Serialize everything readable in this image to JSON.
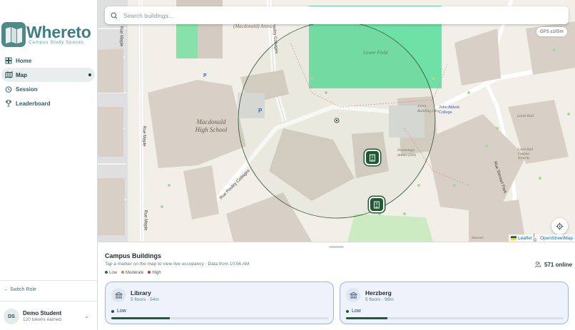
{
  "app": {
    "name": "Whereto",
    "tagline": "Campus Study Spaces"
  },
  "nav": {
    "items": [
      {
        "label": "Home",
        "icon": "home-icon"
      },
      {
        "label": "Map",
        "icon": "map-icon",
        "active": true
      },
      {
        "label": "Session",
        "icon": "timer-icon"
      },
      {
        "label": "Leaderboard",
        "icon": "trophy-icon"
      }
    ]
  },
  "sidebar": {
    "switch_role": "← Switch Role"
  },
  "user": {
    "initials": "DS",
    "name": "Demo Student",
    "tokens": "120 tokens earned"
  },
  "map": {
    "search_placeholder": "Search buildings...",
    "gps": "GPS ±105m",
    "attribution": {
      "leaflet": "Leaflet",
      "sep": " | © ",
      "osm": "OpenStreetMap"
    },
    "labels": {
      "macdonald_arena": "(Macdonald) Arena",
      "lower_field": "Lower Field",
      "macdonald_hs": "Macdonald High School",
      "jones_building": "Jones Building (JB)",
      "john_abbott": "John Abbott College",
      "laird_hall": "Laird Hall",
      "laird_security": "Laird Hall Campus Security",
      "hochelaga": "Hochelaga Annex (HA)",
      "stewart": "Stewart"
    },
    "streets": {
      "maple1": "Rue Maple",
      "maple2": "Rue Maple",
      "maple3": "Rue Maple",
      "cottages": "Rue Poultry Cottages",
      "stewart_park": "Rue Stewart Park",
      "cottages_top": "Poultry Cottages"
    }
  },
  "panel": {
    "title": "Campus Buildings",
    "subtitle": "Tap a marker on the map to view live occupancy · Data from 10:56 AM",
    "legend": [
      {
        "label": "Low",
        "color": "#2e6b3a"
      },
      {
        "label": "Moderate",
        "color": "#d08b2c"
      },
      {
        "label": "High",
        "color": "#c0392b"
      }
    ],
    "online": "571 online"
  },
  "buildings": [
    {
      "name": "Library",
      "meta": "5 floors · 54m",
      "level": "Low",
      "occupancy": 0.27
    },
    {
      "name": "Herzberg",
      "meta": "5 floors · 99m",
      "level": "Low",
      "occupancy": 0.19
    }
  ]
}
